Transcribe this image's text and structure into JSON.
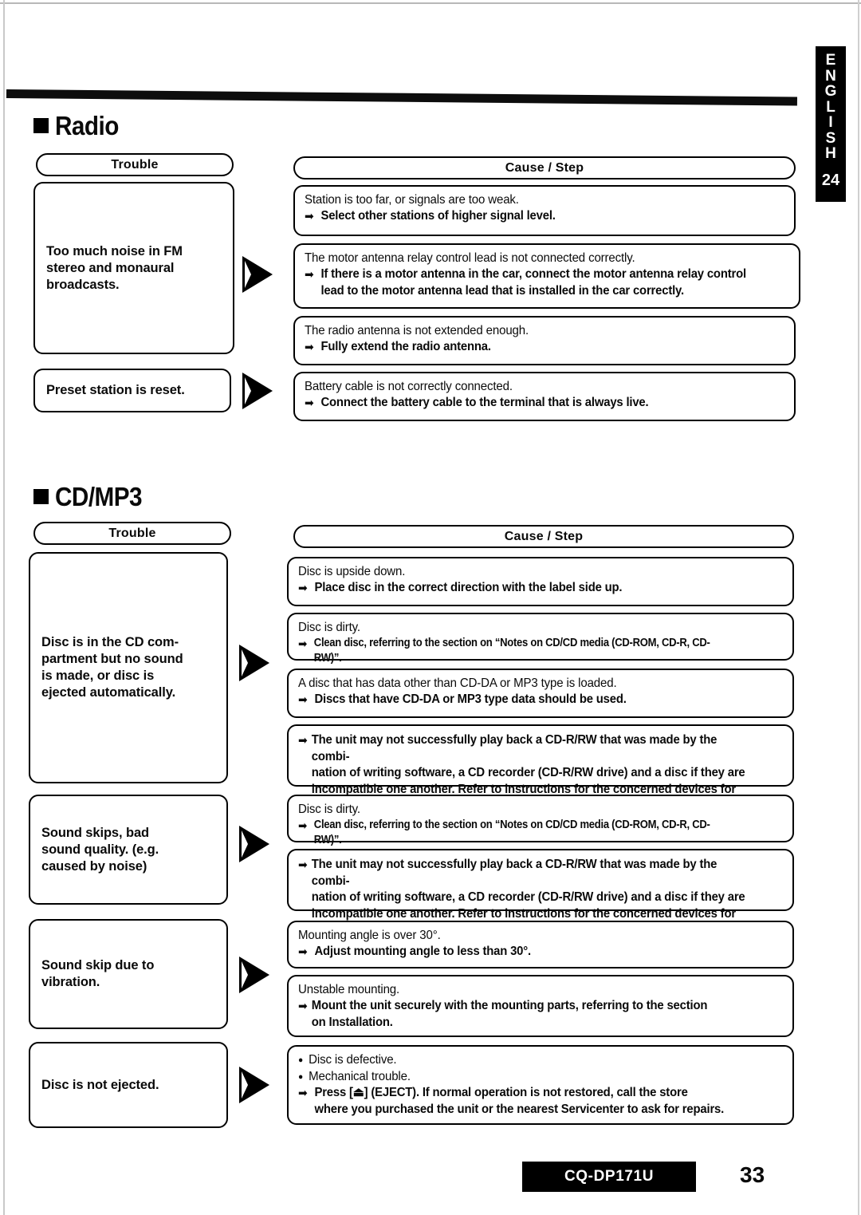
{
  "page": {
    "language_tab": {
      "letters": [
        "E",
        "N",
        "G",
        "L",
        "I",
        "S",
        "H"
      ],
      "number": "24"
    },
    "model": "CQ-DP171U",
    "page_number": "33",
    "column_headers": {
      "trouble": "Trouble",
      "cause": "Cause / Step"
    }
  },
  "sections": [
    {
      "id": "radio",
      "title": "Radio",
      "rows": [
        {
          "trouble": "Too much noise in FM\nstereo and monaural\nbroadcasts.",
          "causes": [
            {
              "cause": "Station is too far, or signals are too weak.",
              "step": "Select other stations of higher signal level."
            },
            {
              "cause": "The motor antenna relay control lead is not connected correctly.",
              "step": "If there is a motor antenna in the car, connect the motor antenna relay control\nlead to the motor antenna lead that is installed in the car correctly."
            },
            {
              "cause": "The radio antenna is not extended enough.",
              "step": "Fully extend the radio antenna."
            }
          ]
        },
        {
          "trouble": "Preset station is reset.",
          "causes": [
            {
              "cause": "Battery cable is not correctly connected.",
              "step": "Connect the battery cable to the terminal that is always live."
            }
          ]
        }
      ]
    },
    {
      "id": "cd-mp3",
      "title": "CD/MP3",
      "rows": [
        {
          "trouble": "Disc is in the CD com-\npartment but no sound\nis made, or disc is\nejected automatically.",
          "causes": [
            {
              "cause": "Disc is upside down.",
              "step": "Place disc in the correct direction with the label side up."
            },
            {
              "cause": "Disc is dirty.",
              "step": "Clean disc, referring to the section on “Notes on CD/CD media (CD-ROM, CD-R, CD-RW)”."
            },
            {
              "cause": "A disc that has data other than CD-DA or MP3 type is loaded.",
              "step": "Discs that have CD-DA or MP3 type data should be used."
            },
            {
              "cause": "",
              "step": "The unit may not successfully play back a CD-R/RW that was made by the combi-\nnation of writing software, a CD recorder (CD-R/RW drive) and a disc if they are\nincompatible one another. Refer to instructions for the concerned devices for details."
            }
          ]
        },
        {
          "trouble": "Sound skips, bad\nsound quality. (e.g.\ncaused by noise)",
          "causes": [
            {
              "cause": "Disc is dirty.",
              "step": "Clean disc, referring to the section on “Notes on CD/CD media (CD-ROM, CD-R, CD-RW)”."
            },
            {
              "cause": "",
              "step": "The unit may not successfully play back a CD-R/RW that was made by the combi-\nnation of writing software, a CD recorder (CD-R/RW drive) and a disc if they are\nincompatible one another. Refer to instructions for the concerned devices for details."
            }
          ]
        },
        {
          "trouble": "Sound skip due to\nvibration.",
          "causes": [
            {
              "cause": "Mounting angle is over 30°.",
              "step": "Adjust mounting angle to less than 30°."
            },
            {
              "cause": "Unstable mounting.",
              "step": "Mount the unit securely with the mounting parts, referring to the section\n on Installation."
            }
          ]
        },
        {
          "trouble": "Disc is not ejected.",
          "causes": [
            {
              "bullets": [
                "Disc is defective.",
                "Mechanical trouble."
              ],
              "step": "Press [⏏] (EJECT). If normal operation is not restored, call the store\n  where you purchased the unit or the nearest Servicenter to ask for repairs."
            }
          ]
        }
      ]
    }
  ]
}
